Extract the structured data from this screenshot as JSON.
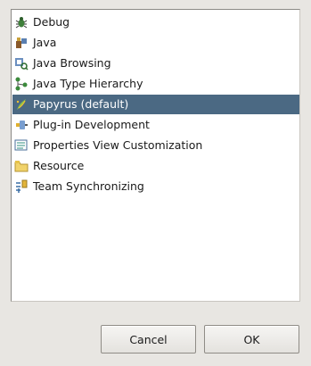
{
  "perspectives": [
    {
      "label": "Debug",
      "icon": "debug-icon",
      "selected": false
    },
    {
      "label": "Java",
      "icon": "java-icon",
      "selected": false
    },
    {
      "label": "Java Browsing",
      "icon": "java-browsing-icon",
      "selected": false
    },
    {
      "label": "Java Type Hierarchy",
      "icon": "java-type-hierarchy-icon",
      "selected": false
    },
    {
      "label": "Papyrus (default)",
      "icon": "papyrus-icon",
      "selected": true
    },
    {
      "label": "Plug-in Development",
      "icon": "plugin-development-icon",
      "selected": false
    },
    {
      "label": "Properties View Customization",
      "icon": "properties-view-icon",
      "selected": false
    },
    {
      "label": "Resource",
      "icon": "resource-folder-icon",
      "selected": false
    },
    {
      "label": "Team Synchronizing",
      "icon": "team-synchronizing-icon",
      "selected": false
    }
  ],
  "buttons": {
    "cancel_label": "Cancel",
    "ok_label": "OK"
  },
  "colors": {
    "selection": "#4b6983",
    "dialog_bg": "#e8e6e2"
  }
}
